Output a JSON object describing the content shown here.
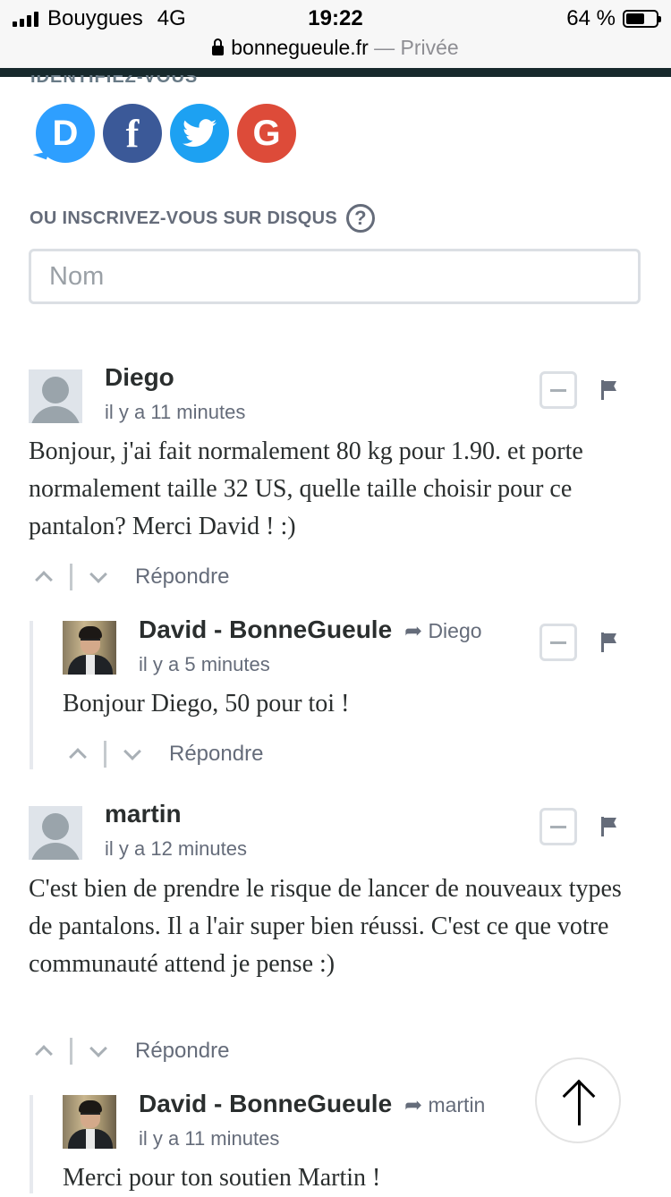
{
  "status_bar": {
    "carrier": "Bouygues",
    "network": "4G",
    "time": "19:22",
    "battery": "64 %",
    "battery_level": 0.64
  },
  "url_bar": {
    "domain": "bonnegueule.fr",
    "mode": "— Privée"
  },
  "login": {
    "social_buttons": [
      {
        "name": "Disqus",
        "glyph": "D",
        "color": "#2e9fff"
      },
      {
        "name": "Facebook",
        "glyph": "f",
        "color": "#3b5998"
      },
      {
        "name": "Twitter",
        "icon": "bird-icon",
        "color": "#1da1f2"
      },
      {
        "name": "Google",
        "glyph": "G",
        "color": "#dd4b39"
      }
    ],
    "signup_label": "OU INSCRIVEZ-VOUS SUR DISQUS",
    "help_glyph": "?",
    "name_placeholder": "Nom"
  },
  "comments": [
    {
      "author": "Diego",
      "time": "il y a 11 minutes",
      "text": "Bonjour, j'ai fait normalement 80 kg pour 1.90. et porte normalement taille 32 US, quelle taille choisir pour ce pantalon? Merci David ! :)",
      "reply_label": "Répondre",
      "reply": {
        "author": "David - BonneGueule",
        "reply_to": "Diego",
        "time": "il y a 5 minutes",
        "text": "Bonjour Diego, 50 pour toi !",
        "reply_label": "Répondre"
      }
    },
    {
      "author": "martin",
      "time": "il y a 12 minutes",
      "text": "C'est bien de prendre le risque de lancer de nouveaux types de pantalons. Il a l'air super bien réussi. C'est ce que votre communauté attend je pense :)",
      "reply_label": "Répondre",
      "reply": {
        "author": "David - BonneGueule",
        "reply_to": "martin",
        "time": "il y a 11 minutes",
        "text": "Merci pour ton soutien Martin !"
      }
    }
  ],
  "colors": {
    "accent_dark": "#17292c",
    "meta_gray": "#656c7a",
    "text": "#2a2e2e"
  }
}
